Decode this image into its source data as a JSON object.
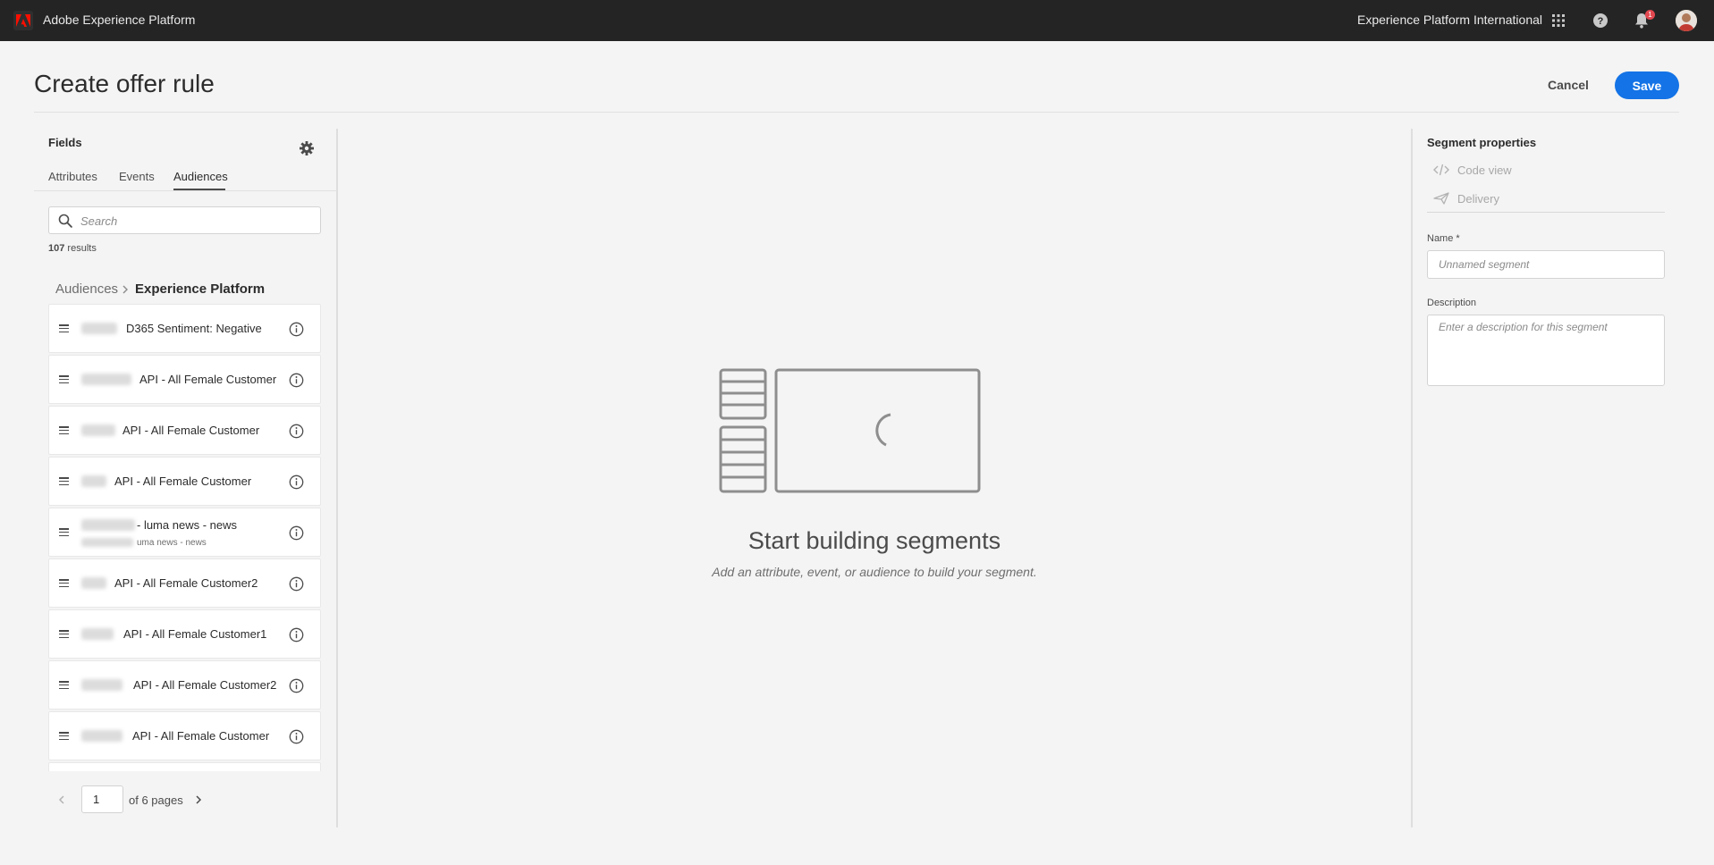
{
  "header": {
    "app_name": "Adobe Experience Platform",
    "org_name": "Experience Platform International",
    "notification_count": "1",
    "icons": [
      "adobe-logo-icon",
      "apps-grid-icon",
      "help-icon",
      "bell-icon",
      "avatar"
    ]
  },
  "page": {
    "title": "Create offer rule",
    "cancel_label": "Cancel",
    "save_label": "Save",
    "accent_color": "#1473e6"
  },
  "fields_panel": {
    "title": "Fields",
    "tabs": [
      {
        "label": "Attributes",
        "active": false
      },
      {
        "label": "Events",
        "active": false
      },
      {
        "label": "Audiences",
        "active": true
      }
    ],
    "search_placeholder": "Search",
    "results_count": "107",
    "results_suffix": "results",
    "breadcrumb": {
      "parent": "Audiences",
      "current": "Experience Platform"
    },
    "items": [
      {
        "label": "D365 Sentiment: Negative",
        "sub": ""
      },
      {
        "label": "API - All Female Customer",
        "sub": ""
      },
      {
        "label": "API - All Female Customer",
        "sub": ""
      },
      {
        "label": "API - All Female Customer",
        "sub": ""
      },
      {
        "label": "- luma news - news",
        "sub": "uma news - news"
      },
      {
        "label": "API - All Female Customer2",
        "sub": ""
      },
      {
        "label": "API - All Female Customer1",
        "sub": ""
      },
      {
        "label": "API - All Female Customer2",
        "sub": ""
      },
      {
        "label": "API - All Female Customer",
        "sub": ""
      }
    ],
    "pagination": {
      "current_page": "1",
      "total_text": "of 6 pages"
    }
  },
  "canvas": {
    "empty_title": "Start building segments",
    "empty_subtitle": "Add an attribute, event, or audience to build your segment."
  },
  "segment_properties": {
    "title": "Segment properties",
    "code_view_label": "Code view",
    "delivery_label": "Delivery",
    "name_label": "Name *",
    "name_placeholder": "Unnamed segment",
    "description_label": "Description",
    "description_placeholder": "Enter a description for this segment"
  }
}
